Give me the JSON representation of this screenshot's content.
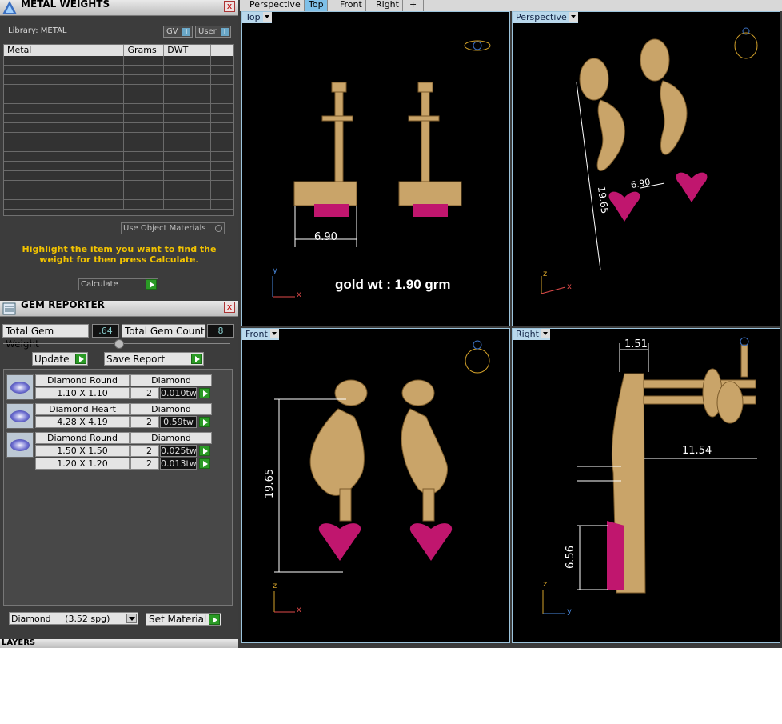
{
  "metal_panel": {
    "title": "METAL WEIGHTS",
    "library_label": "Library: METAL",
    "gv_label": "GV",
    "user_label": "User",
    "toggle_glyph": "I",
    "columns": [
      "Metal",
      "Grams",
      "DWT"
    ],
    "use_object_materials": "Use Object Materials",
    "hint": "Highlight the item you want to find the weight for then press Calculate.",
    "calculate_label": "Calculate"
  },
  "gem_panel": {
    "title": "GEM REPORTER",
    "total_weight_label": "Total Gem Weight",
    "total_weight_value": ".64",
    "total_count_label": "Total Gem Count",
    "total_count_value": "8",
    "update_label": "Update",
    "save_report_label": "Save Report",
    "groups": [
      {
        "name": "Diamond Round",
        "material": "Diamond",
        "rows": [
          {
            "size": "1.10 X 1.10",
            "count": "2",
            "tw": "0.010tw"
          }
        ]
      },
      {
        "name": "Diamond Heart",
        "material": "Diamond",
        "rows": [
          {
            "size": "4.28 X 4.19",
            "count": "2",
            "tw": "0.59tw"
          }
        ]
      },
      {
        "name": "Diamond Round",
        "material": "Diamond",
        "rows": [
          {
            "size": "1.50 X 1.50",
            "count": "2",
            "tw": "0.025tw"
          },
          {
            "size": "1.20 X 1.20",
            "count": "2",
            "tw": "0.013tw"
          }
        ]
      }
    ],
    "material_select": "Diamond     (3.52 spg)",
    "set_material_label": "Set Material"
  },
  "close_glyph": "x",
  "layers_label": "LAYERS",
  "tabs": [
    "Perspective",
    "Top",
    "Front",
    "Right",
    "+"
  ],
  "active_tab": "Top",
  "viewports": {
    "top": {
      "label": "Top",
      "dims": [
        "6.90"
      ],
      "note": "gold wt : 1.90 grm",
      "axes": [
        "y",
        "x"
      ]
    },
    "perspective": {
      "label": "Perspective",
      "dims": [
        "19.65",
        "6.90"
      ],
      "axes": [
        "z",
        "x"
      ]
    },
    "front": {
      "label": "Front",
      "dims": [
        "19.65"
      ],
      "axes": [
        "z",
        "x"
      ]
    },
    "right": {
      "label": "Right",
      "dims": [
        "1.51",
        "11.54",
        "6.56"
      ],
      "axes": [
        "z",
        "y"
      ]
    }
  },
  "colors": {
    "gold": "#c9a469",
    "gem": "#c0166e",
    "panel": "#3c3c3c",
    "accent": "#f2c300"
  }
}
